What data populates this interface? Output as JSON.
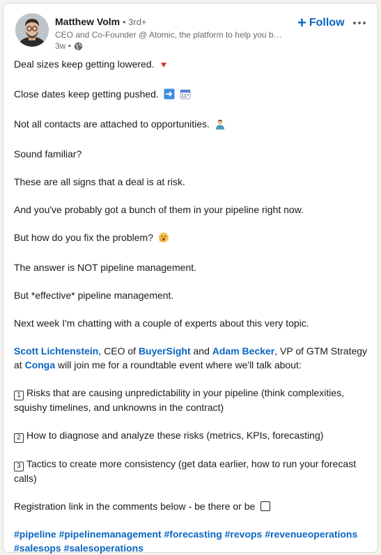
{
  "author": {
    "name": "Matthew Volm",
    "degree": "• 3rd+",
    "headline": "CEO and Co-Founder @ Atomic, the platform to help you build a predictable business",
    "time": "3w •"
  },
  "actions": {
    "follow_label": "Follow"
  },
  "post": {
    "p1": "Deal sizes keep getting lowered.",
    "p2": "Close dates keep getting pushed.",
    "p3": "Not all contacts are attached to opportunities.",
    "p4": "Sound familiar?",
    "p5": "These are all signs that a deal is at risk.",
    "p6": "And you've probably got a bunch of them in your pipeline right now.",
    "p7": "But how do you fix the problem?",
    "p8": "The answer is NOT pipeline management.",
    "p9": "But *effective* pipeline management.",
    "p10": "Next week I'm chatting with a couple of experts about this very topic.",
    "p11": {
      "mention1": "Scott Lichtenstein",
      "t1": ", CEO of ",
      "mention2": "BuyerSight",
      "t2": " and ",
      "mention3": "Adam Becker",
      "t3": ", VP of GTM Strategy at ",
      "mention4": "Conga",
      "t4": " will join me for a roundtable event where we'll talk about:"
    },
    "item1": "Risks that are causing unpredictability in your pipeline (think complexities, squishy timelines, and unknowns in the contract)",
    "item2": "How to diagnose and analyze these risks (metrics, KPIs, forecasting)",
    "item3": "Tactics to create more consistency (get data earlier, how to run your forecast calls)",
    "keycaps": [
      "1",
      "2",
      "3"
    ],
    "p12": "Registration link in the comments below - be there or be",
    "hashtags_line1": "#pipeline #pipelinemanagement #forecasting #revops #revenueoperations",
    "hashtags_line2": "#salesops #salesoperations"
  },
  "colors": {
    "accent": "#0a66c2",
    "text": "#191919",
    "muted": "#666666"
  },
  "icons": [
    "globe-icon",
    "plus-icon",
    "more-icon",
    "red-triangle-down-emoji",
    "right-arrow-emoji",
    "calendar-emoji",
    "person-emoji",
    "hushed-face-emoji",
    "checkbox-icon"
  ]
}
